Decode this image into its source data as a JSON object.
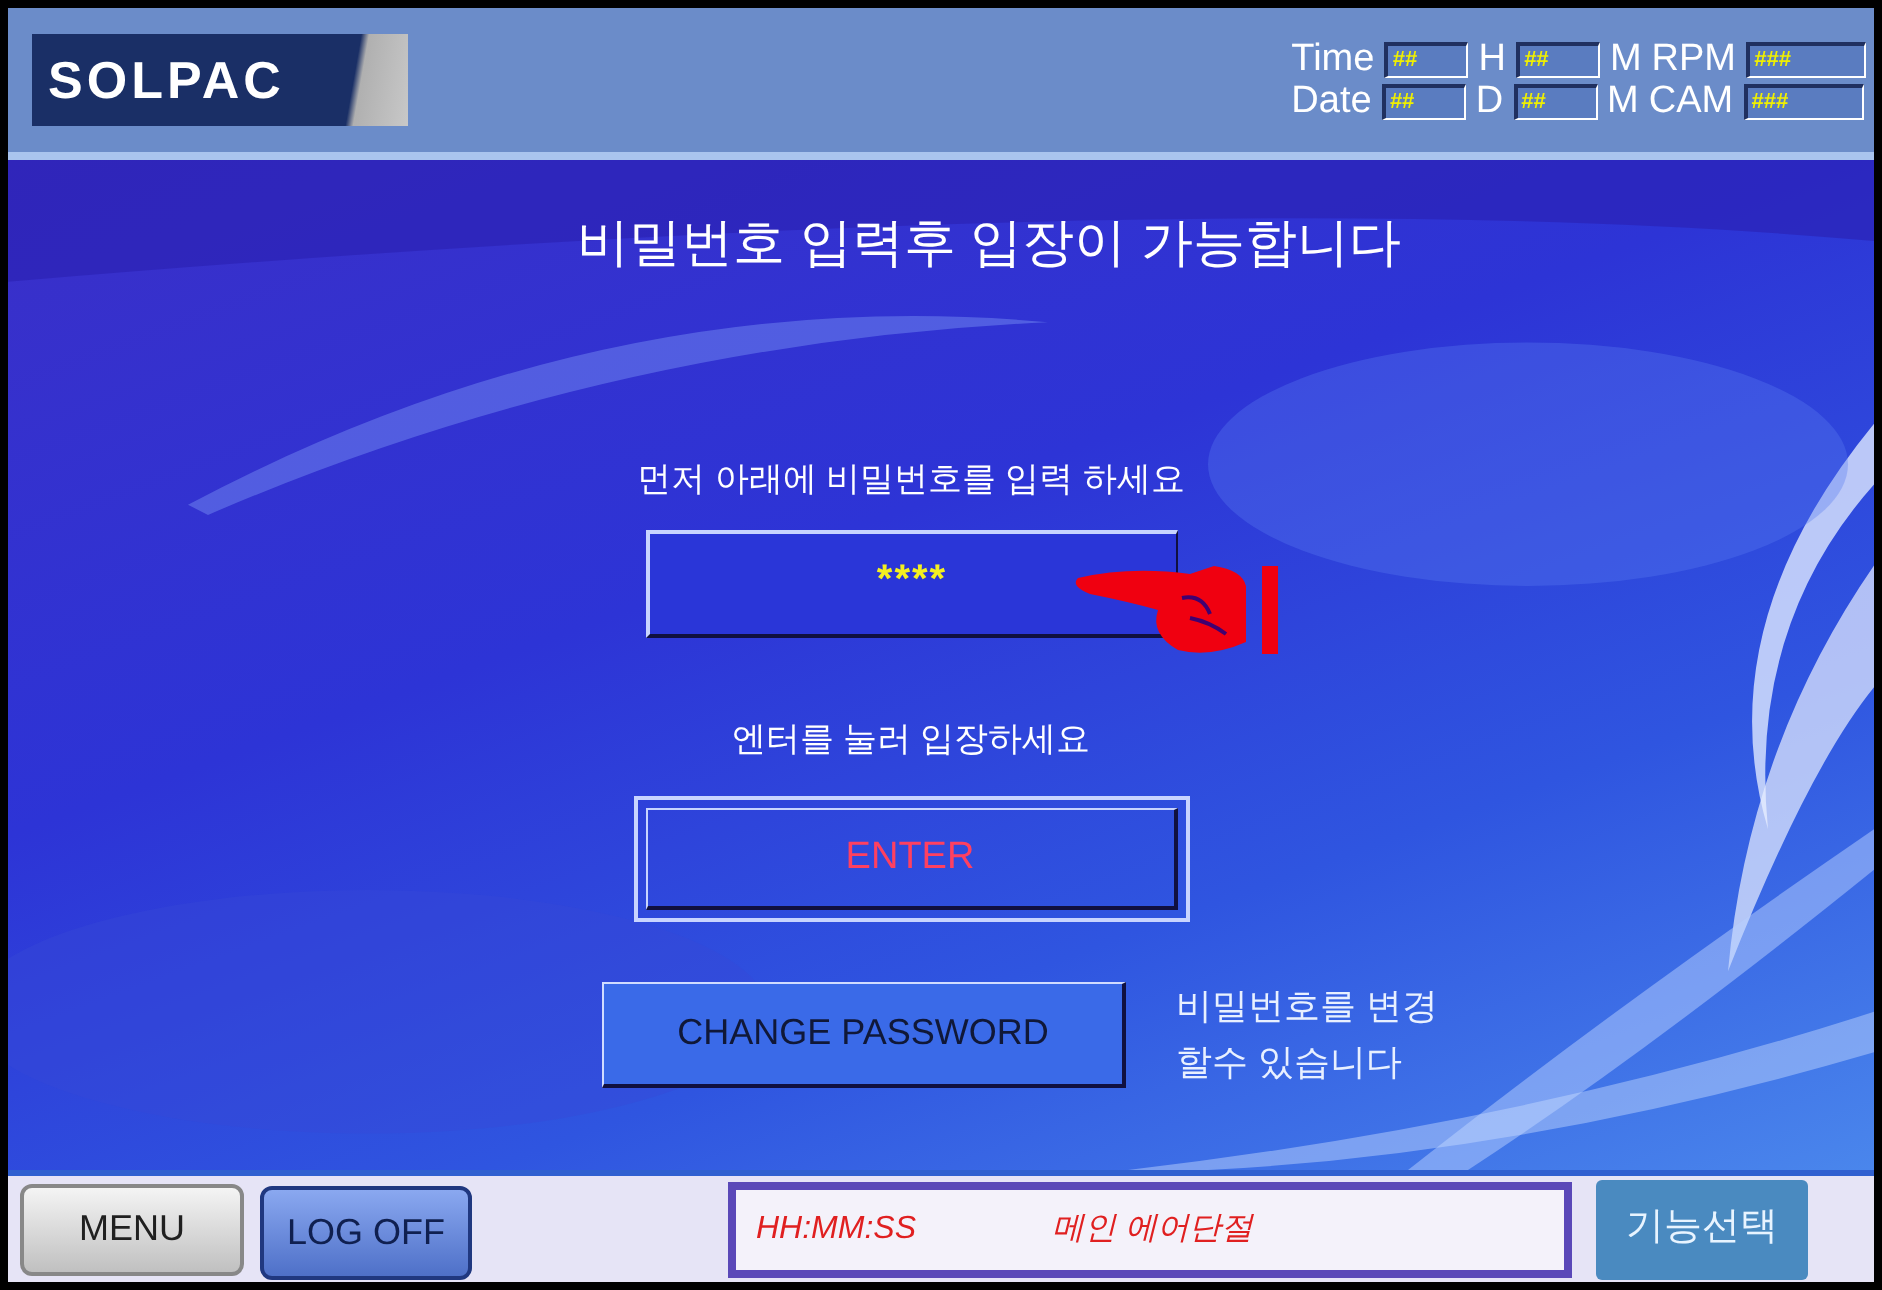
{
  "header": {
    "logo": "SOLPAC",
    "readouts": [
      {
        "label": "Time",
        "value": "##",
        "unit": "H",
        "value2": "##",
        "unit2": "M",
        "label2": "RPM",
        "value3": "###"
      },
      {
        "label": "Date",
        "value": "##",
        "unit": "D",
        "value2": "##",
        "unit2": "M",
        "label2": "CAM",
        "value3": "###"
      }
    ]
  },
  "main": {
    "title": "비밀번호 입력후 입장이 가능합니다",
    "password_prompt": "먼저 아래에 비밀번호를 입력 하세요",
    "password_field": {
      "value": "****"
    },
    "enter_prompt": "엔터를 눌러 입장하세요",
    "enter_button": "ENTER",
    "change_password_button": "CHANGE PASSWORD",
    "change_password_note": [
      "비밀번호를 변경",
      "할수 있습니다"
    ]
  },
  "bottom_bar": {
    "menu_button": "MENU",
    "logoff_button": "LOG OFF",
    "status_time": "HH:MM:SS",
    "status_message": "메인 에어단절",
    "function_button": "기능선택"
  }
}
